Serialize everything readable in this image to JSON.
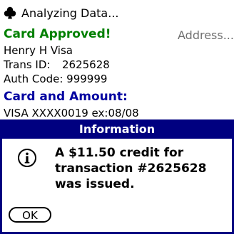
{
  "header": {
    "title": "Analyzing Data...",
    "icon": "clubs-icon"
  },
  "status": {
    "approved_label": "Card Approved!",
    "address_link": "Address...",
    "cardholder_name": "Henry H Visa",
    "trans_id_label": "Trans ID:",
    "trans_id_value": "2625628",
    "auth_code": "Auth Code: 999999"
  },
  "card": {
    "section_label": "Card and Amount:",
    "card_line": "VISA XXXX0019 ex:08/08"
  },
  "dialog": {
    "title": "Information",
    "icon": "info-icon",
    "message_line1": "A $11.50 credit for",
    "message_line2": "transaction #2625628",
    "message_line3": "was issued.",
    "ok_label": "OK"
  },
  "colors": {
    "approved": "#008000",
    "section": "#0000a0",
    "dialog_header": "#000080"
  }
}
